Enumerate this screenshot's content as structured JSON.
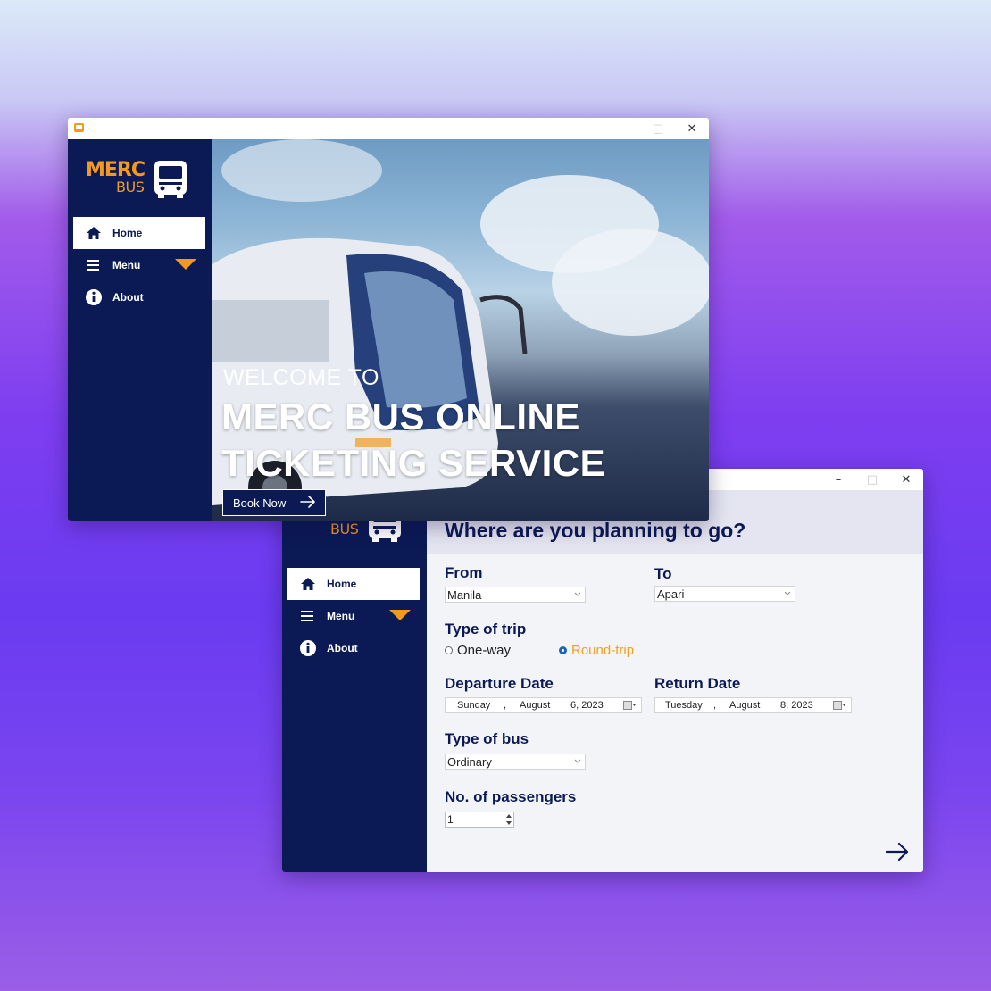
{
  "colors": {
    "navy": "#0b1a55",
    "orange": "#f39a1e",
    "radio_blue": "#1d64b8"
  },
  "brand": {
    "name_top": "MERC",
    "name_bottom": "BUS"
  },
  "sidebar": {
    "items": [
      {
        "label": "Home",
        "icon": "home-icon"
      },
      {
        "label": "Menu",
        "icon": "hamburger-icon"
      },
      {
        "label": "About",
        "icon": "info-icon"
      }
    ]
  },
  "welcome_window": {
    "welcome_text": "WELCOME TO",
    "title_line1": "MERC BUS ONLINE",
    "title_line2": "TICKETING SERVICE",
    "book_button": "Book Now"
  },
  "booking_window": {
    "heading": "Where are you planning to go?",
    "from_label": "From",
    "from_value": "Manila",
    "to_label": "To",
    "to_value": "Apari",
    "trip_label": "Type of trip",
    "trip_options": [
      {
        "label": "One-way",
        "selected": false
      },
      {
        "label": "Round-trip",
        "selected": true
      }
    ],
    "departure_label": "Departure Date",
    "departure": {
      "day": "Sunday",
      "sep": ",",
      "month": "August",
      "date": "6, 2023"
    },
    "return_label": "Return Date",
    "return": {
      "day": "Tuesday",
      "sep": ",",
      "month": "August",
      "date": "8, 2023"
    },
    "bus_label": "Type of bus",
    "bus_value": "Ordinary",
    "passengers_label": "No. of passengers",
    "passengers_value": "1"
  },
  "window_controls": {
    "minimize": "–",
    "maximize": "□",
    "close": "✕"
  }
}
